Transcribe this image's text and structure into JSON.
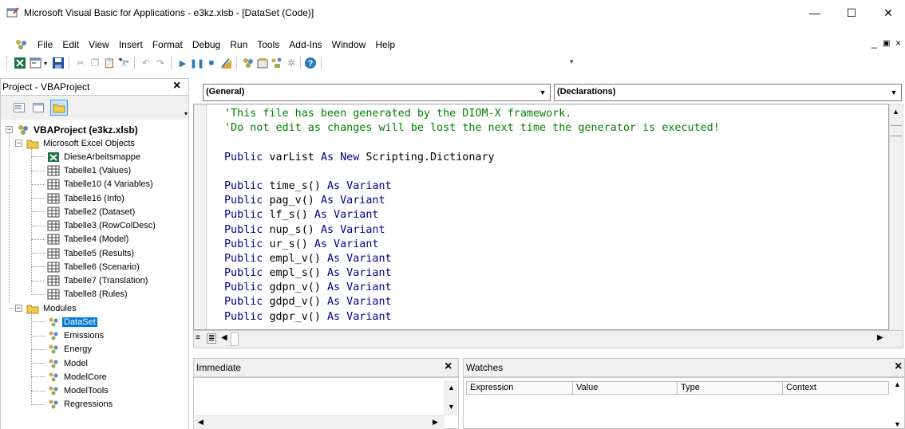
{
  "window": {
    "title": "Microsoft Visual Basic for Applications - e3kz.xlsb - [DataSet (Code)]",
    "minimize_icon": "minimize-icon",
    "maximize_icon": "maximize-icon",
    "close_icon": "close-icon"
  },
  "menubar": {
    "items": [
      "File",
      "Edit",
      "View",
      "Insert",
      "Format",
      "Debug",
      "Run",
      "Tools",
      "Add-Ins",
      "Window",
      "Help"
    ],
    "mdi_controls": "_ ♂ ×"
  },
  "toolbar": {
    "buttons": [
      "excel-icon",
      "insert-userform-icon",
      "save-icon",
      "cut-icon",
      "copy-icon",
      "paste-icon",
      "find-icon",
      "undo-icon",
      "redo-icon",
      "run-icon",
      "break-icon",
      "reset-icon",
      "design-mode-icon",
      "project-explorer-icon",
      "properties-icon",
      "object-browser-icon",
      "toolbox-icon",
      "help-icon"
    ]
  },
  "project_panel": {
    "title": "Project - VBAProject",
    "close": "×",
    "root": "VBAProject (e3kz.xlsb)",
    "excel_objects_folder": "Microsoft Excel Objects",
    "excel_objects": [
      "DieseArbeitsmappe",
      "Tabelle1 (Values)",
      "Tabelle10 (4 Variables)",
      "Tabelle16 (Info)",
      "Tabelle2 (Dataset)",
      "Tabelle3 (RowColDesc)",
      "Tabelle4 (Model)",
      "Tabelle5 (Results)",
      "Tabelle6 (Scenario)",
      "Tabelle7 (Translation)",
      "Tabelle8 (Rules)"
    ],
    "modules_folder": "Modules",
    "modules": [
      "DataSet",
      "Emissions",
      "Energy",
      "Model",
      "ModelCore",
      "ModelTools",
      "Regressions"
    ],
    "selected_module": "DataSet"
  },
  "code_window": {
    "object_combo": "(General)",
    "procedure_combo": "(Declarations)",
    "lines": [
      {
        "comment": "'This file has been generated by the DIOM-X framework."
      },
      {
        "comment": "'Do not edit as changes will be lost the next time the generator is executed!"
      },
      {
        "blank": true
      },
      {
        "kw1": "Public ",
        "id": "varList ",
        "kw2": "As New ",
        "id2": "Scripting.Dictionary"
      },
      {
        "blank": true
      },
      {
        "kw1": "Public ",
        "id": "time_s() ",
        "kw2": "As Variant"
      },
      {
        "kw1": "Public ",
        "id": "pag_v() ",
        "kw2": "As Variant"
      },
      {
        "kw1": "Public ",
        "id": "lf_s() ",
        "kw2": "As Variant"
      },
      {
        "kw1": "Public ",
        "id": "nup_s() ",
        "kw2": "As Variant"
      },
      {
        "kw1": "Public ",
        "id": "ur_s() ",
        "kw2": "As Variant"
      },
      {
        "kw1": "Public ",
        "id": "empl_v() ",
        "kw2": "As Variant"
      },
      {
        "kw1": "Public ",
        "id": "empl_s() ",
        "kw2": "As Variant"
      },
      {
        "kw1": "Public ",
        "id": "gdpn_v() ",
        "kw2": "As Variant"
      },
      {
        "kw1": "Public ",
        "id": "gdpd_v() ",
        "kw2": "As Variant"
      },
      {
        "kw1": "Public ",
        "id": "gdpr_v() ",
        "kw2": "As Variant"
      }
    ]
  },
  "immediate": {
    "title": "Immediate",
    "close": "×"
  },
  "watches": {
    "title": "Watches",
    "close": "×",
    "columns": [
      "Expression",
      "Value",
      "Type",
      "Context"
    ]
  }
}
